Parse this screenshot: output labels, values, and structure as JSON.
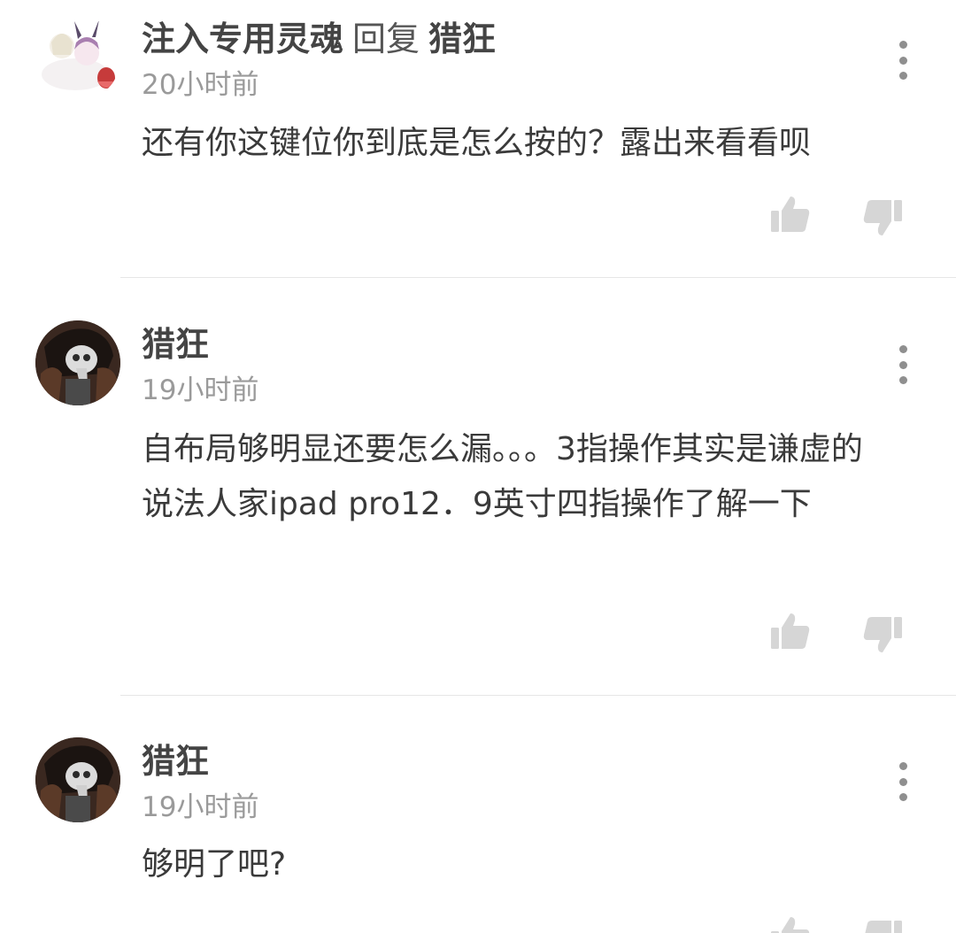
{
  "comments": [
    {
      "author": "注入专用灵魂",
      "reply_word": "回复",
      "reply_to": "猎狂",
      "time": "20小时前",
      "text": "还有你这键位你到底是怎么按的？露出来看看呗",
      "avatar_icon": "anime-girls-avatar-icon"
    },
    {
      "author": "猎狂",
      "time": "19小时前",
      "text": "自布局够明显还要怎么漏。。。3指操作其实是谦虚的说法人家ipad pro12．9英寸四指操作了解一下",
      "avatar_icon": "plague-doctor-avatar-icon"
    },
    {
      "author": "猎狂",
      "time": "19小时前",
      "text": "够明了吧?",
      "avatar_icon": "plague-doctor-avatar-icon"
    }
  ],
  "colors": {
    "icon_gray": "#d6d6d6",
    "text_dark": "#3a3a3a",
    "timestamp_gray": "#9a9a9a",
    "divider": "#e6e6e6"
  }
}
